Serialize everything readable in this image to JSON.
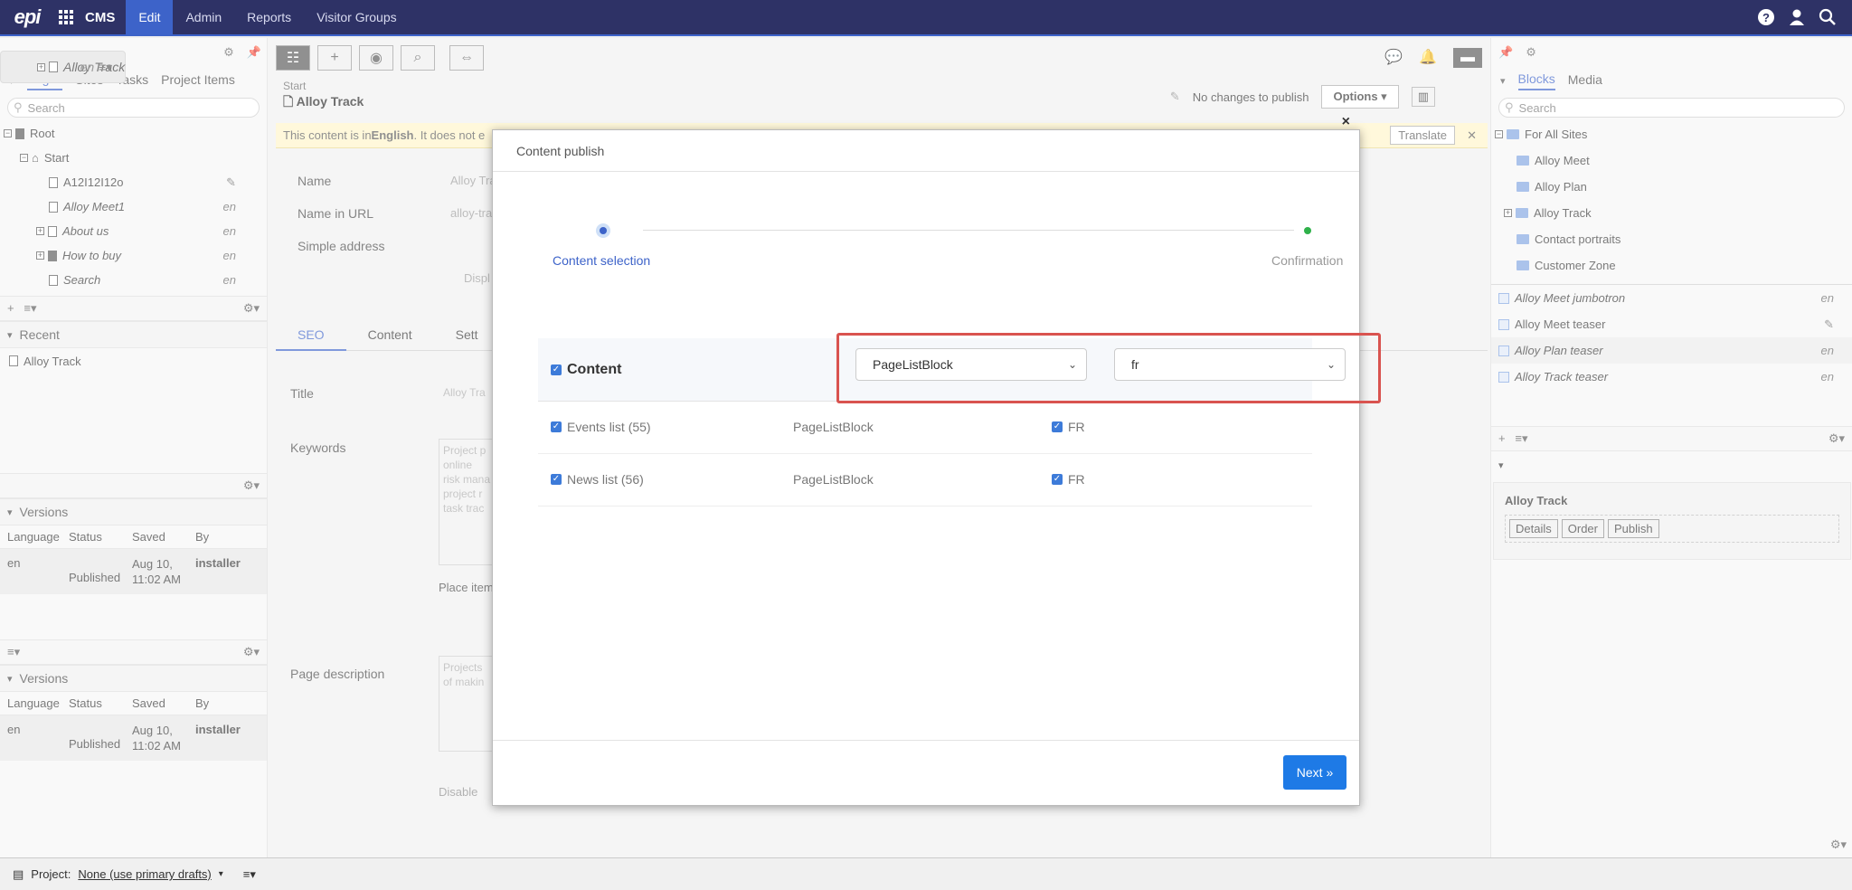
{
  "topbar": {
    "logo": "epi",
    "app": "CMS",
    "nav": [
      "Edit",
      "Admin",
      "Reports",
      "Visitor Groups"
    ]
  },
  "left": {
    "tabs": [
      "Pages",
      "Sites",
      "Tasks",
      "Project Items"
    ],
    "search_placeholder": "Search",
    "tree": [
      {
        "label": "Root",
        "lang": ""
      },
      {
        "label": "Start",
        "lang": ""
      },
      {
        "label": "A12I12I12o",
        "lang": ""
      },
      {
        "label": "Alloy Track",
        "lang": "en"
      },
      {
        "label": "Alloy Meet1",
        "lang": "en"
      },
      {
        "label": "About us",
        "lang": "en"
      },
      {
        "label": "How to buy",
        "lang": "en"
      },
      {
        "label": "Search",
        "lang": "en"
      }
    ],
    "recent_title": "Recent",
    "recent_items": [
      "Alloy Track"
    ],
    "versions_title": "Versions",
    "versions_columns": [
      "Language",
      "Status",
      "Saved",
      "By"
    ],
    "versions_rows": [
      {
        "language": "en",
        "status": "Published",
        "saved_date": "Aug 10,",
        "saved_time": "11:02 AM",
        "by": "installer"
      }
    ]
  },
  "center": {
    "breadcrumb": "Start",
    "title": "Alloy Track",
    "publish_status": "No changes to publish",
    "options_label": "Options",
    "notice_prefix": "This content is in ",
    "notice_lang": "English",
    "notice_suffix": ". It does not e",
    "translate_label": "Translate",
    "fields": {
      "name_label": "Name",
      "name_value": "Alloy Tra",
      "url_label": "Name in URL",
      "url_value": "alloy-tra",
      "simple_label": "Simple address",
      "display_label": "Displ"
    },
    "form_tabs": [
      "SEO",
      "Content",
      "Sett"
    ],
    "seo": {
      "title_label": "Title",
      "title_value": "Alloy Tra",
      "keywords_label": "Keywords",
      "keywords_lines": [
        "Project p",
        "online",
        "risk mana",
        "project r",
        "task trac"
      ],
      "place_label": "Place item",
      "desc_label": "Page description",
      "desc_lines": [
        "Projects",
        "of makin"
      ],
      "disable_label": "Disable"
    }
  },
  "right": {
    "tabs": [
      "Blocks",
      "Media"
    ],
    "search_placeholder": "Search",
    "folders": [
      "For All Sites",
      "Alloy Meet",
      "Alloy Plan",
      "Alloy Track",
      "Contact portraits",
      "Customer Zone"
    ],
    "blocks": [
      {
        "label": "Alloy Meet jumbotron",
        "lang": "en"
      },
      {
        "label": "Alloy Meet teaser",
        "lang": ""
      },
      {
        "label": "Alloy Plan teaser",
        "lang": "en"
      },
      {
        "label": "Alloy Track teaser",
        "lang": "en"
      }
    ],
    "panel_title": "Alloy Track",
    "panel_buttons": [
      "Details",
      "Order",
      "Publish"
    ]
  },
  "footer": {
    "project_label": "Project:",
    "project_value": "None (use primary drafts)"
  },
  "dialog": {
    "title": "Content publish",
    "close": "×",
    "step1": "Content selection",
    "step2": "Confirmation",
    "content_label": "Content",
    "type_select": "PageListBlock",
    "lang_select": "fr",
    "rows": [
      {
        "name": "Events list (55)",
        "type": "PageListBlock",
        "lang": "FR"
      },
      {
        "name": "News list (56)",
        "type": "PageListBlock",
        "lang": "FR"
      }
    ],
    "next_label": "Next »"
  },
  "colors": {
    "topbar": "#2e3266",
    "accent": "#3d63c9",
    "primary_button": "#1e7ae6",
    "highlight": "#d9534f"
  }
}
